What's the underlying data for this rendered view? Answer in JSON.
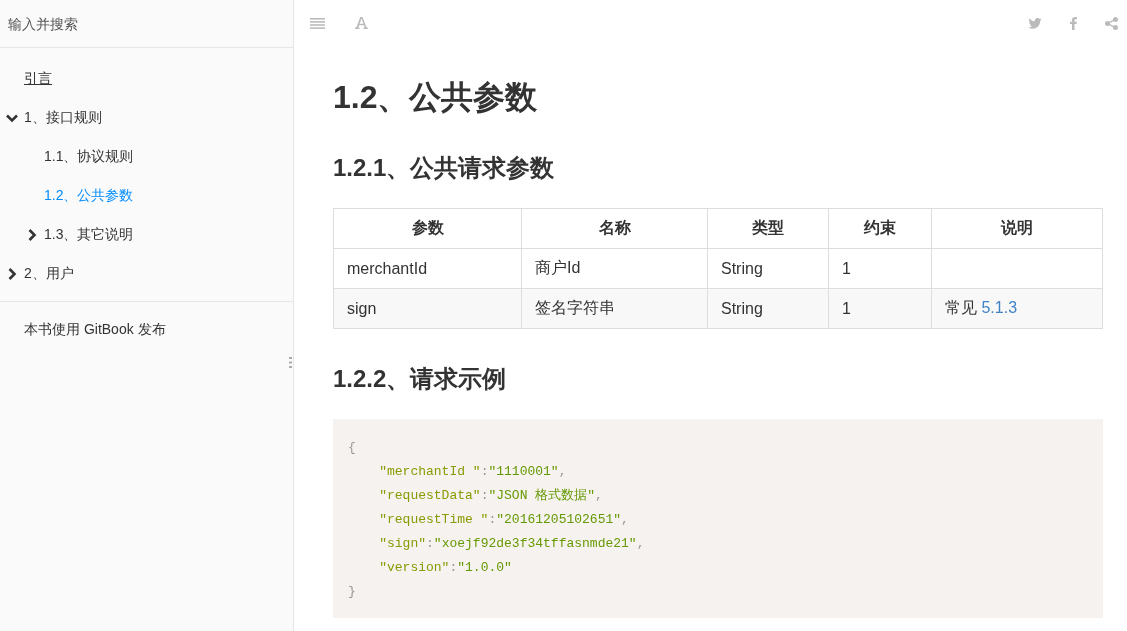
{
  "sidebar": {
    "search": {
      "placeholder": "输入并搜索"
    },
    "items": [
      {
        "label": "引言",
        "selected": false,
        "focused": true
      },
      {
        "label": "1、接口规则",
        "selected": false,
        "focused": false,
        "expanded": true,
        "children": [
          {
            "label": "1.1、协议规则",
            "selected": false,
            "focused": false
          },
          {
            "label": "1.2、公共参数",
            "selected": true,
            "focused": false
          },
          {
            "label": "1.3、其它说明",
            "selected": false,
            "focused": false,
            "expanded": false
          }
        ]
      },
      {
        "label": "2、用户",
        "selected": false,
        "focused": false,
        "expanded": false
      }
    ],
    "footer_link": "本书使用 GitBook 发布"
  },
  "toolbar": {
    "left": [
      {
        "kind": "menu"
      },
      {
        "kind": "font"
      }
    ],
    "right": [
      {
        "kind": "twitter"
      },
      {
        "kind": "facebook"
      },
      {
        "kind": "share"
      }
    ]
  },
  "content": {
    "title": "1.2、公共参数",
    "sections": [
      {
        "kind": "table",
        "heading": "1.2.1、公共请求参数",
        "columns": [
          "参数",
          "名称",
          "类型",
          "约束",
          "说明"
        ],
        "rows": [
          [
            {
              "text": "merchantId"
            },
            {
              "text": "商户Id"
            },
            {
              "text": "String"
            },
            {
              "text": "1"
            },
            {
              "text": ""
            }
          ],
          [
            {
              "text": "sign"
            },
            {
              "text": "签名字符串"
            },
            {
              "text": "String"
            },
            {
              "text": "1"
            },
            {
              "text": "常见 ",
              "link": "5.1.3"
            }
          ]
        ]
      },
      {
        "kind": "code",
        "heading": "1.2.2、请求示例",
        "lines": [
          {
            "tokens": [
              {
                "kind": "punct",
                "text": "{"
              }
            ]
          },
          {
            "tokens": [
              {
                "kind": "key",
                "text": "    \"merchantId \""
              },
              {
                "kind": "punct",
                "text": ":"
              },
              {
                "kind": "string",
                "text": "\"1110001\""
              },
              {
                "kind": "punct",
                "text": ","
              }
            ]
          },
          {
            "tokens": [
              {
                "kind": "key",
                "text": "    \"requestData\""
              },
              {
                "kind": "punct",
                "text": ":"
              },
              {
                "kind": "string",
                "text": "\"JSON 格式数据\""
              },
              {
                "kind": "punct",
                "text": ","
              }
            ]
          },
          {
            "tokens": [
              {
                "kind": "key",
                "text": "    \"requestTime \""
              },
              {
                "kind": "punct",
                "text": ":"
              },
              {
                "kind": "string",
                "text": "\"20161205102651\""
              },
              {
                "kind": "punct",
                "text": ","
              }
            ]
          },
          {
            "tokens": [
              {
                "kind": "key",
                "text": "    \"sign\""
              },
              {
                "kind": "punct",
                "text": ":"
              },
              {
                "kind": "string",
                "text": "\"xoejf92de3f34tffasnmde21\""
              },
              {
                "kind": "punct",
                "text": ","
              }
            ]
          },
          {
            "tokens": [
              {
                "kind": "key",
                "text": "    \"version\""
              },
              {
                "kind": "punct",
                "text": ":"
              },
              {
                "kind": "string",
                "text": "\"1.0.0\""
              }
            ]
          },
          {
            "tokens": [
              {
                "kind": "punct",
                "text": "}"
              }
            ]
          }
        ]
      }
    ]
  }
}
